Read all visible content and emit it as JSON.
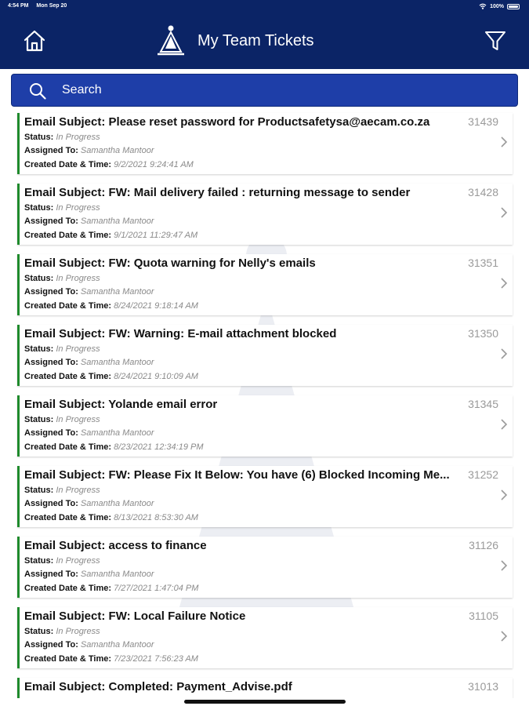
{
  "status_bar": {
    "time": "4:54 PM",
    "date": "Mon Sep 20",
    "battery": "100%"
  },
  "header": {
    "title": "My Team Tickets"
  },
  "search": {
    "placeholder": "Search"
  },
  "labels": {
    "subject": "Email Subject:",
    "status": "Status:",
    "assigned": "Assigned To:",
    "created": "Created Date & Time:"
  },
  "colors": {
    "header_bg": "#0b2466",
    "search_bg": "#1e3ea8",
    "accent_bar": "#1f8a2c"
  },
  "tickets": [
    {
      "subject": "Please reset password for Productsafetysa@aecam.co.za",
      "id": "31439",
      "status": "In Progress",
      "assigned": "Samantha Mantoor",
      "created": "9/2/2021 9:24:41 AM"
    },
    {
      "subject": "FW: Mail delivery failed  : returning message to sender",
      "id": "31428",
      "status": "In Progress",
      "assigned": "Samantha Mantoor",
      "created": "9/1/2021 11:29:47 AM"
    },
    {
      "subject": "FW: Quota warning for Nelly's emails",
      "id": "31351",
      "status": "In Progress",
      "assigned": "Samantha Mantoor",
      "created": "8/24/2021 9:18:14 AM"
    },
    {
      "subject": "FW: Warning: E-mail attachment blocked",
      "id": "31350",
      "status": "In Progress",
      "assigned": "Samantha Mantoor",
      "created": "8/24/2021 9:10:09 AM"
    },
    {
      "subject": "Yolande email error",
      "id": "31345",
      "status": "In Progress",
      "assigned": "Samantha Mantoor",
      "created": "8/23/2021 12:34:19 PM"
    },
    {
      "subject": "FW: Please Fix It Below: You have (6) Blocked Incoming Me...",
      "id": "31252",
      "status": "In Progress",
      "assigned": "Samantha Mantoor",
      "created": "8/13/2021 8:53:30 AM"
    },
    {
      "subject": "access to finance",
      "id": "31126",
      "status": "In Progress",
      "assigned": "Samantha Mantoor",
      "created": "7/27/2021 1:47:04 PM"
    },
    {
      "subject": "FW: Local Failure Notice",
      "id": "31105",
      "status": "In Progress",
      "assigned": "Samantha Mantoor",
      "created": "7/23/2021 7:56:23 AM"
    },
    {
      "subject": "Completed: Payment_Advise.pdf",
      "id": "31013",
      "status": "",
      "assigned": "",
      "created": ""
    }
  ]
}
